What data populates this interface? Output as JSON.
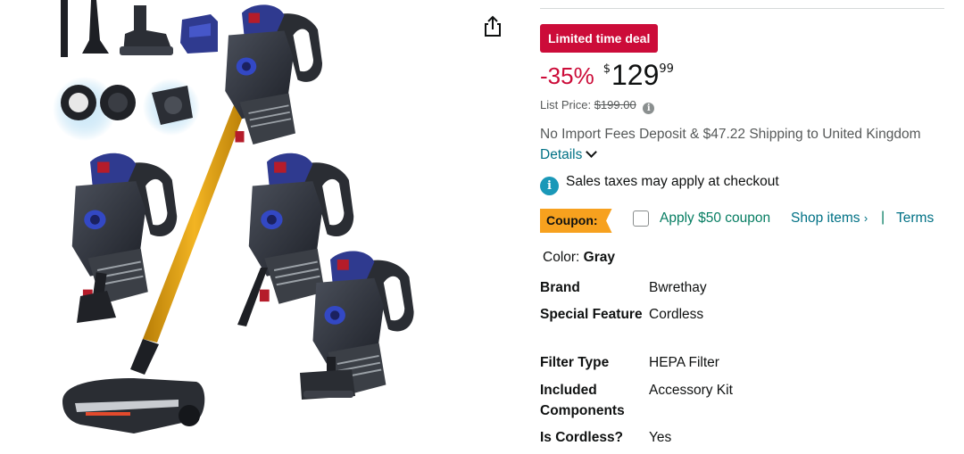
{
  "pricing": {
    "deal_badge": "Limited time deal",
    "discount": "-35%",
    "currency_symbol": "$",
    "price_whole": "129",
    "price_fraction": "99",
    "list_price_label": "List Price:",
    "list_price_value": "$199.00"
  },
  "shipping": {
    "text": "No Import Fees Deposit & $47.22 Shipping to United Kingdom",
    "details_link": "Details"
  },
  "tax_notice": "Sales taxes may apply at checkout",
  "coupon": {
    "badge": "Coupon:",
    "apply_text": "Apply $50 coupon",
    "shop_items": "Shop items",
    "shop_items_arrow": "›",
    "separator": "|",
    "terms": "Terms",
    "checked": false
  },
  "color": {
    "label": "Color:",
    "value": "Gray"
  },
  "specs": [
    {
      "label": "Brand",
      "value": "Bwrethay"
    },
    {
      "label": "Special Feature",
      "value": "Cordless"
    },
    {
      "label": "Filter Type",
      "value": "HEPA Filter"
    },
    {
      "label": "Included Components",
      "value": "Accessory Kit"
    },
    {
      "label": "Is Cordless?",
      "value": "Yes"
    }
  ],
  "icons": {
    "share": "share-icon",
    "info": "info-icon",
    "chevron": "chevron-down-icon"
  },
  "colors": {
    "deal_red": "#cc0c39",
    "link_teal": "#007185",
    "coupon_orange": "#f7a11e",
    "coupon_green": "#067d62",
    "info_blue": "#1a98b8",
    "vacuum_gold": "#e8a317",
    "vacuum_blue": "#2f3a8f"
  }
}
